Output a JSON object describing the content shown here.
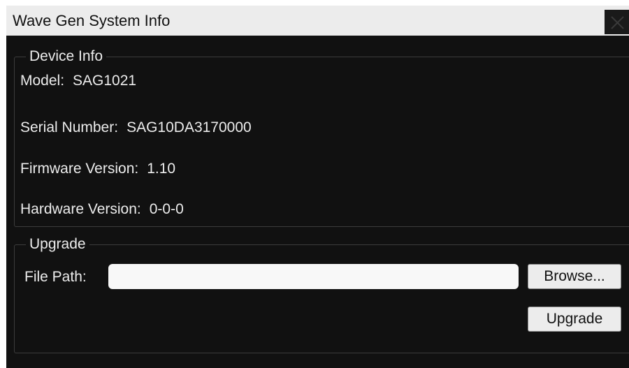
{
  "window": {
    "title": "Wave Gen System Info",
    "close_icon": "close-icon"
  },
  "device_info": {
    "legend": "Device Info",
    "rows": [
      {
        "label": "Model:",
        "value": "SAG1021"
      },
      {
        "label": "Serial Number:",
        "value": "SAG10DA3170000"
      },
      {
        "label": "Firmware Version:",
        "value": "1.10"
      },
      {
        "label": "Hardware Version:",
        "value": "0-0-0"
      }
    ]
  },
  "upgrade": {
    "legend": "Upgrade",
    "file_path_label": "File Path:",
    "file_path_value": "",
    "browse_label": "Browse...",
    "upgrade_label": "Upgrade"
  },
  "colors": {
    "dialog_background": "#111111",
    "titlebar_background": "#ececec",
    "text": "#ececec",
    "input_background": "#f8f8f8"
  }
}
